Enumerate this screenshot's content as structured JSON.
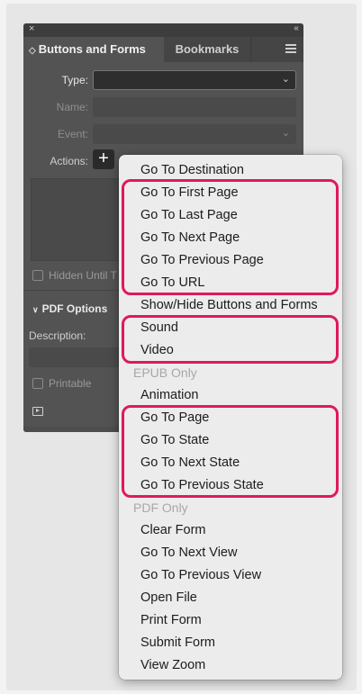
{
  "panel": {
    "close_glyph": "×",
    "collapse_glyph": "‹‹",
    "tabs": [
      {
        "label": "Buttons and Forms",
        "active": true
      },
      {
        "label": "Bookmarks",
        "active": false
      }
    ],
    "tab_arrows": "◇",
    "fields": {
      "type_label": "Type:",
      "name_label": "Name:",
      "event_label": "Event:",
      "actions_label": "Actions:",
      "add_action_glyph": "+",
      "hidden_until_label": "Hidden Until T",
      "pdf_options_label": "PDF Options",
      "description_label": "Description:",
      "printable_label": "Printable"
    }
  },
  "menu": {
    "items": [
      {
        "label": "Go To Destination",
        "kind": "item"
      },
      {
        "label": "Go To First Page",
        "kind": "item"
      },
      {
        "label": "Go To Last Page",
        "kind": "item"
      },
      {
        "label": "Go To Next Page",
        "kind": "item"
      },
      {
        "label": "Go To Previous Page",
        "kind": "item"
      },
      {
        "label": "Go To URL",
        "kind": "item"
      },
      {
        "label": "Show/Hide Buttons and Forms",
        "kind": "item"
      },
      {
        "label": "Sound",
        "kind": "item"
      },
      {
        "label": "Video",
        "kind": "item"
      },
      {
        "label": "EPUB Only",
        "kind": "header"
      },
      {
        "label": "Animation",
        "kind": "item"
      },
      {
        "label": "Go To Page",
        "kind": "item"
      },
      {
        "label": "Go To State",
        "kind": "item"
      },
      {
        "label": "Go To Next State",
        "kind": "item"
      },
      {
        "label": "Go To Previous State",
        "kind": "item"
      },
      {
        "label": "PDF Only",
        "kind": "header"
      },
      {
        "label": "Clear Form",
        "kind": "item"
      },
      {
        "label": "Go To Next View",
        "kind": "item"
      },
      {
        "label": "Go To Previous View",
        "kind": "item"
      },
      {
        "label": "Open File",
        "kind": "item"
      },
      {
        "label": "Print Form",
        "kind": "item"
      },
      {
        "label": "Submit Form",
        "kind": "item"
      },
      {
        "label": "View Zoom",
        "kind": "item"
      }
    ]
  },
  "colors": {
    "highlight": "#e0195a",
    "panel_bg": "#535353",
    "menu_bg": "#ececec"
  }
}
